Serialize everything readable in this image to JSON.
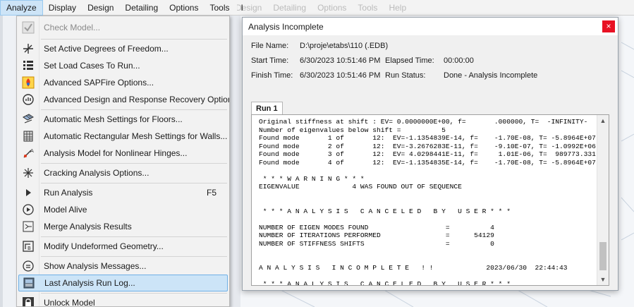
{
  "menubar": {
    "items": [
      "Analyze",
      "Display",
      "Design",
      "Detailing",
      "Options",
      "Tools",
      "I"
    ]
  },
  "background": {
    "tabs": [
      "Design",
      "Detailing",
      "Options",
      "Tools",
      "Help"
    ]
  },
  "menu": {
    "items": [
      {
        "label": "Check Model...",
        "icon": "check-icon",
        "disabled": true
      },
      {
        "label": "Set Active Degrees of Freedom...",
        "icon": "dof-icon"
      },
      {
        "label": "Set Load Cases To Run...",
        "icon": "load-cases-icon"
      },
      {
        "label": "Advanced SAPFire Options...",
        "icon": "sapfire-icon"
      },
      {
        "label": "Advanced Design and Response Recovery Options...",
        "icon": "recovery-icon"
      },
      {
        "label": "Automatic Mesh Settings for Floors...",
        "icon": "mesh-floor-icon"
      },
      {
        "label": "Automatic Rectangular Mesh Settings for Walls...",
        "icon": "mesh-wall-icon"
      },
      {
        "label": "Analysis Model for Nonlinear Hinges...",
        "icon": "hinge-icon"
      },
      {
        "label": "Cracking Analysis Options...",
        "icon": "crack-icon"
      },
      {
        "label": "Run Analysis",
        "shortcut": "F5",
        "icon": "run-icon"
      },
      {
        "label": "Model Alive",
        "icon": "model-alive-icon"
      },
      {
        "label": "Merge Analysis Results",
        "icon": "merge-icon"
      },
      {
        "label": "Modify Undeformed Geometry...",
        "icon": "geometry-icon"
      },
      {
        "label": "Show Analysis Messages...",
        "icon": "messages-icon"
      },
      {
        "label": "Last Analysis Run Log...",
        "icon": "log-icon",
        "selected": true
      },
      {
        "label": "Unlock Model",
        "icon": "lock-icon"
      }
    ]
  },
  "dialog": {
    "title": "Analysis Incomplete",
    "close": "×",
    "file_label": "File Name:",
    "file_value": "D:\\proje\\etabs\\110 (.EDB)",
    "start_label": "Start Time:",
    "start_value": "6/30/2023 10:51:46 PM",
    "elapsed_label": "Elapsed Time:",
    "elapsed_value": "00:00:00",
    "finish_label": "Finish Time:",
    "finish_value": "6/30/2023 10:51:46 PM",
    "status_label": "Run Status:",
    "status_value": "Done - Analysis Incomplete",
    "tab": "Run 1",
    "log": "Original stiffness at shift : EV= 0.0000000E+00, f=       .000000, T=  -INFINITY-\nNumber of eigenvalues below shift =          5\nFound mode       1 of       12:  EV=-1.1354839E-14, f=    -1.70E-08, T= -5.8964E+07\nFound mode       2 of       12:  EV=-3.2676283E-11, f=    -9.10E-07, T= -1.0992E+06\nFound mode       3 of       12:  EV= 4.0298441E-11, f=     1.01E-06, T=  989773.331\nFound mode       4 of       12:  EV=-1.1354835E-14, f=    -1.70E-08, T= -5.8964E+07\n\n * * * W A R N I N G * * *\nEIGENVALUE             4 WAS FOUND OUT OF SEQUENCE\n\n\n * * * A N A L Y S I S   C A N C E L E D   B Y   U S E R * * *\n\nNUMBER OF EIGEN MODES FOUND                   =          4\nNUMBER OF ITERATIONS PERFORMED                =      54129\nNUMBER OF STIFFNESS SHIFTS                    =          0\n\n\nA N A L Y S I S   I N C O M P L E T E   ! !             2023/06/30  22:44:43\n\n * * * A N A L Y S I S   C A N C E L E D   B Y   U S E R * * *"
  },
  "colors": {
    "selection": "#cce4f7",
    "close_red": "#e81123",
    "menu_bg": "#f2f2f2"
  }
}
